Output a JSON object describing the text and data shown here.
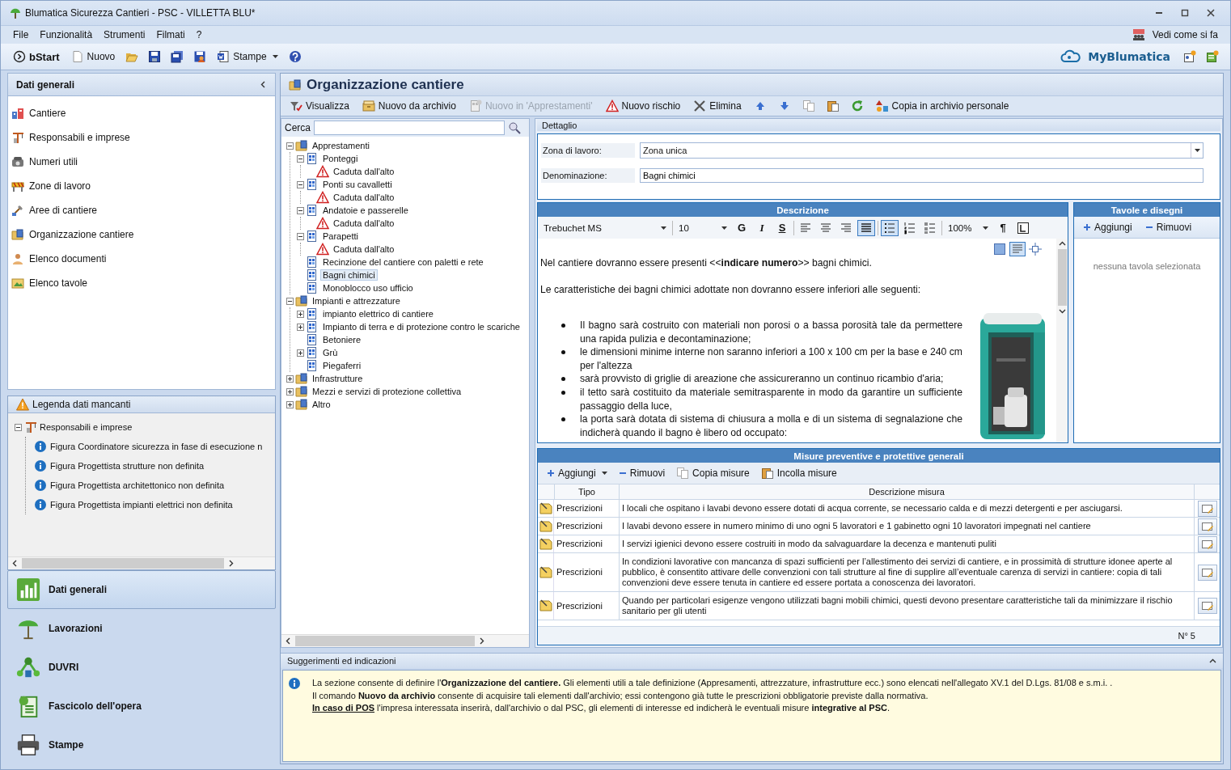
{
  "window": {
    "title": "Blumatica Sicurezza Cantieri - PSC - VILLETTA BLU*"
  },
  "menu": {
    "items": [
      "File",
      "Funzionalità",
      "Strumenti",
      "Filmati",
      "?"
    ],
    "help_link": "Vedi come si fa"
  },
  "toolbar": {
    "start": "bStart",
    "new": "Nuovo",
    "print": "Stampe",
    "brand": "MyBlumatica"
  },
  "sidebar": {
    "title": "Dati generali",
    "items": [
      "Cantiere",
      "Responsabili e imprese",
      "Numeri utili",
      "Zone di lavoro",
      "Aree di cantiere",
      "Organizzazione cantiere",
      "Elenco documenti",
      "Elenco tavole"
    ]
  },
  "legend": {
    "title": "Legenda dati mancanti",
    "tree": [
      {
        "label": "Responsabili e imprese",
        "expanded": true,
        "children": [
          {
            "label": "Figura Coordinatore sicurezza in fase di esecuzione n"
          },
          {
            "label": "Figura Progettista strutture non definita"
          },
          {
            "label": "Figura Progettista architettonico non definita"
          },
          {
            "label": "Figura Progettista impianti elettrici non definita"
          }
        ]
      }
    ]
  },
  "nav": [
    {
      "label": "Dati generali",
      "selected": true
    },
    {
      "label": "Lavorazioni",
      "selected": false
    },
    {
      "label": "DUVRI",
      "selected": false
    },
    {
      "label": "Fascicolo dell'opera",
      "selected": false
    },
    {
      "label": "Stampe",
      "selected": false
    }
  ],
  "content": {
    "title": "Organizzazione cantiere",
    "toolbar": [
      {
        "label": "Visualizza",
        "disabled": false
      },
      {
        "label": "Nuovo da archivio",
        "disabled": false
      },
      {
        "label": "Nuovo in 'Apprestamenti'",
        "disabled": true
      },
      {
        "label": "Nuovo rischio",
        "disabled": false
      },
      {
        "label": "Elimina",
        "disabled": false
      },
      {
        "label": "Copia in archivio personale",
        "disabled": false
      }
    ],
    "search_label": "Cerca",
    "tree": [
      {
        "label": "Apprestamenti",
        "kind": "group",
        "expanded": true,
        "selected": false,
        "children": [
          {
            "label": "Ponteggi",
            "kind": "item",
            "expanded": true,
            "selected": false,
            "children": [
              {
                "label": "Caduta dall'alto",
                "kind": "risk",
                "selected": false
              }
            ]
          },
          {
            "label": "Ponti su cavalletti",
            "kind": "item",
            "expanded": true,
            "selected": false,
            "children": [
              {
                "label": "Caduta dall'alto",
                "kind": "risk",
                "selected": false
              }
            ]
          },
          {
            "label": "Andatoie e passerelle",
            "kind": "item",
            "expanded": true,
            "selected": false,
            "children": [
              {
                "label": "Caduta dall'alto",
                "kind": "risk",
                "selected": false
              }
            ]
          },
          {
            "label": "Parapetti",
            "kind": "item",
            "expanded": true,
            "selected": false,
            "children": [
              {
                "label": "Caduta dall'alto",
                "kind": "risk",
                "selected": false
              }
            ]
          },
          {
            "label": "Recinzione del cantiere con paletti e rete",
            "kind": "item",
            "selected": false
          },
          {
            "label": "Bagni chimici",
            "kind": "item",
            "selected": true
          },
          {
            "label": "Monoblocco uso ufficio",
            "kind": "item",
            "selected": false
          }
        ]
      },
      {
        "label": "Impianti e attrezzature",
        "kind": "group",
        "expanded": true,
        "selected": false,
        "children": [
          {
            "label": "impianto elettrico di cantiere",
            "kind": "item",
            "expanded": false,
            "selected": false
          },
          {
            "label": "Impianto di terra e di protezione contro le scariche",
            "kind": "item",
            "expanded": false,
            "selected": false
          },
          {
            "label": "Betoniere",
            "kind": "item",
            "selected": false
          },
          {
            "label": "Grù",
            "kind": "item",
            "expanded": false,
            "selected": false
          },
          {
            "label": "Piegaferri",
            "kind": "item",
            "selected": false
          }
        ]
      },
      {
        "label": "Infrastrutture",
        "kind": "group",
        "expanded": false,
        "selected": false
      },
      {
        "label": "Mezzi e servizi di protezione collettiva",
        "kind": "group",
        "expanded": false,
        "selected": false
      },
      {
        "label": "Altro",
        "kind": "group",
        "expanded": false,
        "selected": false
      }
    ]
  },
  "detail": {
    "title": "Dettaglio",
    "fields": [
      {
        "label": "Zona di lavoro:",
        "value": "Zona unica",
        "kind": "select"
      },
      {
        "label": "Denominazione:",
        "value": "Bagni chimici",
        "kind": "text"
      }
    ]
  },
  "description": {
    "title": "Descrizione",
    "font": "Trebuchet MS",
    "size": "10",
    "zoom": "100%",
    "pilcrow": "¶",
    "format_buttons": [
      {
        "label": "G",
        "selected": false
      },
      {
        "label": "I",
        "selected": false
      },
      {
        "label": "S",
        "selected": false
      }
    ],
    "align_buttons": [
      {
        "selected": false
      },
      {
        "selected": false
      },
      {
        "selected": false
      },
      {
        "selected": true
      }
    ],
    "list_buttons": [
      {
        "selected": true
      },
      {
        "selected": false
      },
      {
        "selected": false
      }
    ],
    "view_buttons": [
      {
        "selected": false
      },
      {
        "selected": true
      },
      {
        "selected": false
      }
    ],
    "paragraphs": [
      "Nel cantiere dovranno essere presenti <<**indicare numero**>> bagni chimici.",
      "Le caratteristiche dei bagni chimici adottate non dovranno essere inferiori alle seguenti:"
    ],
    "bullets": [
      "Il bagno sarà costruito con materiali non porosi o a bassa porosità tale da permettere una rapida pulizia e decontaminazione;",
      "le dimensioni minime interne non saranno inferiori a 100 x 100 cm per la base e 240 cm per l'altezza",
      "sarà provvisto di griglie di areazione che assicureranno un continuo ricambio d'aria;",
      "il tetto sarà costituito da materiale semitrasparente in modo da garantire un sufficiente passaggio della luce,",
      "la porta sarà dotata di sistema di chiusura a molla e di un sistema di segnalazione che indicherà quando il bagno è libero od occupato:"
    ],
    "image": {
      "kind": "picture"
    }
  },
  "drawings": {
    "title": "Tavole e disegni",
    "add": "Aggiungi",
    "remove": "Rimuovi",
    "empty": "nessuna tavola selezionata"
  },
  "measures": {
    "title": "Misure preventive e protettive generali",
    "actions": [
      "Aggiungi",
      "Rimuovi",
      "Copia misure",
      "Incolla misure"
    ],
    "columns": [
      "Tipo",
      "Descrizione misura"
    ],
    "rows": [
      {
        "type": "Prescrizioni",
        "description": "I locali che ospitano i lavabi devono essere dotati di  acqua corrente, se necessario calda e di mezzi detergenti e per asciugarsi."
      },
      {
        "type": "Prescrizioni",
        "description": "I lavabi devono essere in numero minimo di uno ogni 5 lavoratori e 1 gabinetto ogni 10 lavoratori impegnati nel cantiere"
      },
      {
        "type": "Prescrizioni",
        "description": "I servizi igienici devono essere costruiti in modo da salvaguardare la decenza e mantenuti puliti"
      },
      {
        "type": "Prescrizioni",
        "description": "In condizioni lavorative con mancanza di spazi sufficienti per l’allestimento dei servizi di cantiere, e in prossimità di strutture idonee aperte al pubblico, è consentito attivare delle convenzioni con tali strutture al fine di supplire all’eventuale carenza di servizi in cantiere: copia di tali convenzioni deve essere tenuta in cantiere ed essere portata a conoscenza dei lavoratori."
      },
      {
        "type": "Prescrizioni",
        "description": "Quando per particolari esigenze vengono utilizzati bagni mobili chimici, questi devono presentare caratteristiche tali da minimizzare il rischio sanitario per gli utenti"
      }
    ],
    "count": "N° 5"
  },
  "hints": {
    "title": "Suggerimenti ed indicazioni",
    "lines": [
      {
        "text": "La sezione consente di definire l'**Organizzazione del cantiere.** Gli elementi utili a tale definizione (Appresamenti, attrezzature, infrastrutture ecc.) sono elencati nell'allegato XV.1 del D.Lgs. 81/08 e s.m.i. ."
      },
      {
        "text": "Il comando **Nuovo da archivio** consente di acquisire tali elementi dall'archivio; essi contengono già tutte le prescrizioni obbligatorie previste dalla normativa."
      },
      {
        "link": "In caso di POS",
        "text": " l'impresa interessata inserirà, dall'archivio o dal PSC, gli elementi di interesse ed indicherà le eventuali misure **integrative al PSC**."
      }
    ]
  }
}
